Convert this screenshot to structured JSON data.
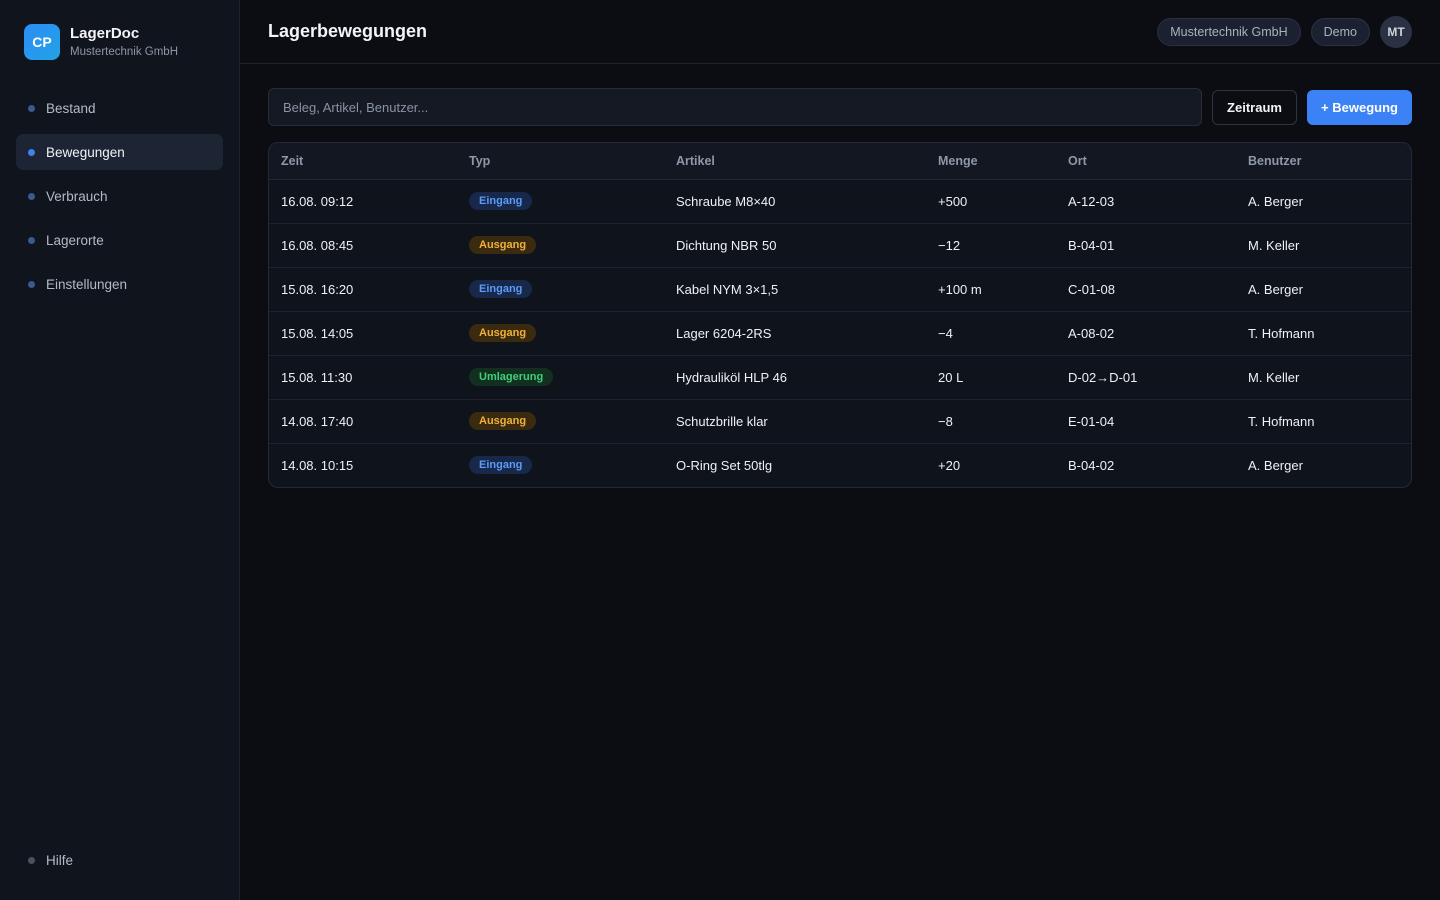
{
  "brand": {
    "logo": "CP",
    "name": "LagerDoc",
    "company": "Mustertechnik GmbH"
  },
  "sidebar": {
    "items": [
      {
        "label": "Bestand",
        "active": false
      },
      {
        "label": "Bewegungen",
        "active": true
      },
      {
        "label": "Verbrauch",
        "active": false
      },
      {
        "label": "Lagerorte",
        "active": false
      },
      {
        "label": "Einstellungen",
        "active": false
      }
    ],
    "help": "Hilfe"
  },
  "header": {
    "title": "Lagerbewegungen",
    "org_pill": "Mustertechnik GmbH",
    "mode_pill": "Demo",
    "avatar": "MT"
  },
  "toolbar": {
    "search_placeholder": "Beleg, Artikel, Benutzer...",
    "period_label": "Zeitraum",
    "add_label": "+ Bewegung"
  },
  "table": {
    "columns": [
      "Zeit",
      "Typ",
      "Artikel",
      "Menge",
      "Ort",
      "Benutzer"
    ],
    "rows": [
      {
        "zeit": "16.08. 09:12",
        "typ": "Eingang",
        "artikel": "Schraube M8×40",
        "menge": "+500",
        "ort": "A-12-03",
        "benutzer": "A. Berger"
      },
      {
        "zeit": "16.08. 08:45",
        "typ": "Ausgang",
        "artikel": "Dichtung NBR 50",
        "menge": "−12",
        "ort": "B-04-01",
        "benutzer": "M. Keller"
      },
      {
        "zeit": "15.08. 16:20",
        "typ": "Eingang",
        "artikel": "Kabel NYM 3×1,5",
        "menge": "+100 m",
        "ort": "C-01-08",
        "benutzer": "A. Berger"
      },
      {
        "zeit": "15.08. 14:05",
        "typ": "Ausgang",
        "artikel": "Lager 6204-2RS",
        "menge": "−4",
        "ort": "A-08-02",
        "benutzer": "T. Hofmann"
      },
      {
        "zeit": "15.08. 11:30",
        "typ": "Umlagerung",
        "artikel": "Hydrauliköl HLP 46",
        "menge": "20 L",
        "ort": "D-02→D-01",
        "benutzer": "M. Keller"
      },
      {
        "zeit": "14.08. 17:40",
        "typ": "Ausgang",
        "artikel": "Schutzbrille klar",
        "menge": "−8",
        "ort": "E-01-04",
        "benutzer": "T. Hofmann"
      },
      {
        "zeit": "14.08. 10:15",
        "typ": "Eingang",
        "artikel": "O-Ring Set 50tlg",
        "menge": "+20",
        "ort": "B-04-02",
        "benutzer": "A. Berger"
      }
    ]
  },
  "colors": {
    "accent": "#3b82f6",
    "eingang": "#5b9bf6",
    "ausgang": "#f0b13a",
    "umlagerung": "#3fcf7a"
  }
}
